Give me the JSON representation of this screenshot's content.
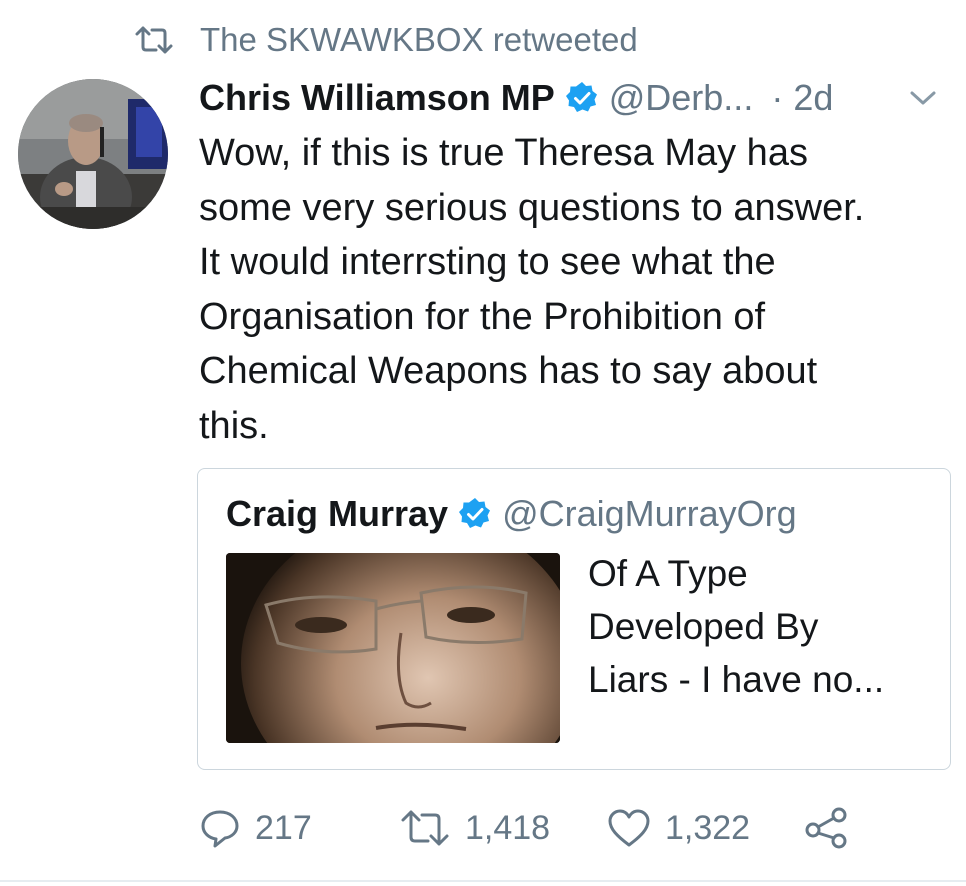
{
  "retweet_bar": {
    "icon": "retweet-icon",
    "text": "The SKWAWKBOX retweeted"
  },
  "tweet": {
    "author_name": "Chris Williamson MP",
    "verified_icon": "verified-badge-icon",
    "handle": "@Derb...",
    "time": "· 2d",
    "menu_icon": "chevron-down-icon",
    "avatar_icon": "avatar-photo",
    "text_lines": [
      "Wow, if this is true Theresa May has",
      "some very serious questions to answer.",
      "It would interrsting to see what the",
      "Organisation for the Prohibition of",
      "Chemical Weapons has to say about",
      "this."
    ]
  },
  "quoted_tweet": {
    "author_name": "Craig Murray",
    "handle": "@CraigMurrayOrg",
    "verified_icon": "verified-badge-icon",
    "image_icon": "portrait-photo",
    "text_lines": [
      "Of A Type",
      "Developed By",
      "Liars - I have no..."
    ]
  },
  "actions": {
    "reply": {
      "icon": "reply-icon",
      "count": "217"
    },
    "retweet": {
      "icon": "retweet-icon",
      "count": "1,418"
    },
    "like": {
      "icon": "heart-icon",
      "count": "1,322"
    },
    "share": {
      "icon": "share-icon"
    }
  },
  "colors": {
    "text_primary": "#14171a",
    "text_secondary": "#657786",
    "verified_blue": "#1da1f2",
    "card_border": "#ccd6dd"
  }
}
